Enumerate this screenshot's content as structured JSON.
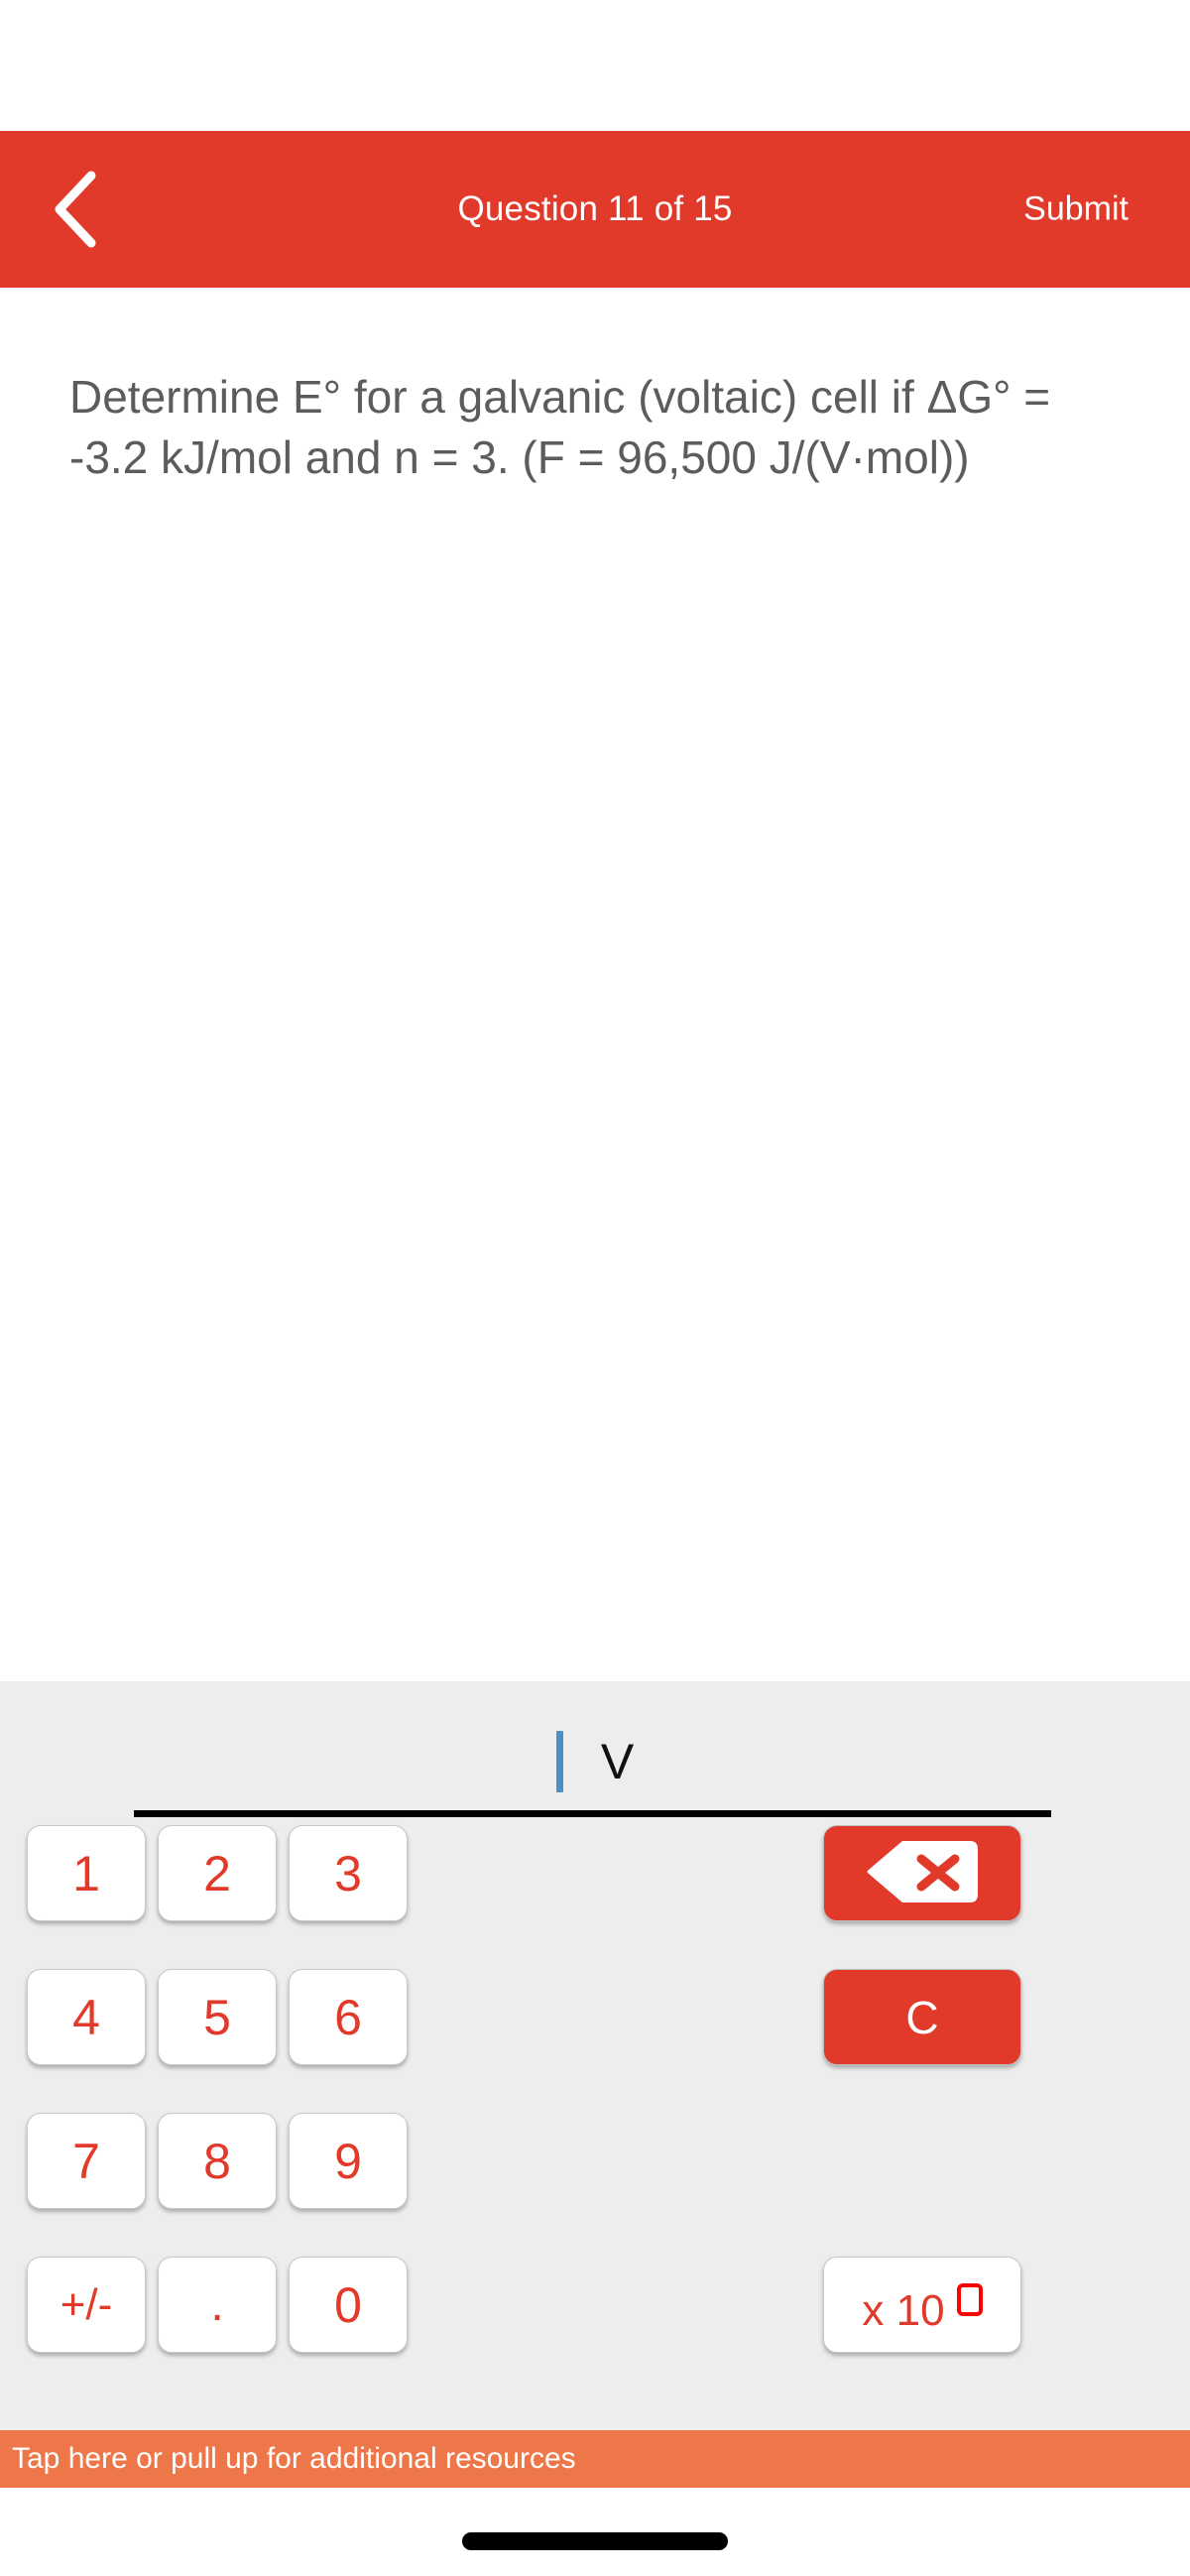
{
  "header": {
    "back_icon": "chevron-left-icon",
    "title": "Question 11 of 15",
    "submit_label": "Submit",
    "background_color": "#E1392A",
    "text_color": "#FFFFFF"
  },
  "question": {
    "text": "Determine E° for a galvanic (voltaic) cell if ΔG° = -3.2 kJ/mol and n = 3. (F = 96,500 J/(V·mol))",
    "text_color": "#5C5C5C"
  },
  "answer_field": {
    "value": "",
    "caret_visible": true,
    "caret_color": "#4A8FC6",
    "unit": "V",
    "underline_color": "#000000"
  },
  "keypad": {
    "background_color": "#EDEDED",
    "key_text_color": "#E1392A",
    "rows": [
      [
        {
          "name": "key-1",
          "label": "1"
        },
        {
          "name": "key-2",
          "label": "2"
        },
        {
          "name": "key-3",
          "label": "3"
        }
      ],
      [
        {
          "name": "key-4",
          "label": "4"
        },
        {
          "name": "key-5",
          "label": "5"
        },
        {
          "name": "key-6",
          "label": "6"
        }
      ],
      [
        {
          "name": "key-7",
          "label": "7"
        },
        {
          "name": "key-8",
          "label": "8"
        },
        {
          "name": "key-9",
          "label": "9"
        }
      ],
      [
        {
          "name": "key-sign",
          "label": "+/-"
        },
        {
          "name": "key-decimal",
          "label": "."
        },
        {
          "name": "key-0",
          "label": "0"
        }
      ]
    ],
    "actions": {
      "backspace": {
        "icon": "backspace-icon",
        "label": "",
        "color": "#E1392A"
      },
      "clear": {
        "label": "C",
        "color": "#E1392A"
      },
      "exponent": {
        "text": "x 10",
        "placeholder_box": true,
        "box_color": "#FF0000"
      }
    }
  },
  "resources_bar": {
    "label": "Tap here or pull up for additional resources",
    "background_color": "#EE7749",
    "text_color": "#FFFFFF"
  },
  "home_indicator": {
    "color": "#000000"
  }
}
